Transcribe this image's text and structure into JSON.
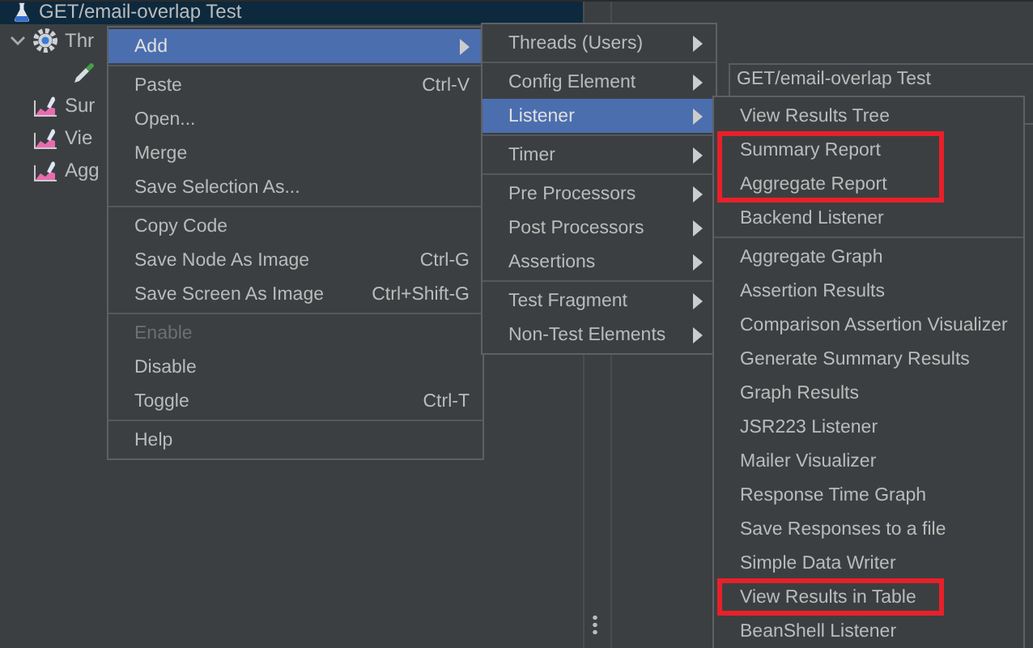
{
  "tree": [
    {
      "label": "GET/email-overlap Test",
      "kind": "test-plan",
      "selected": true,
      "children": [
        {
          "label": "Thr",
          "kind": "thread-group",
          "selected": false,
          "expanded": true,
          "children": [
            {
              "kind": "sampler",
              "selected": false
            }
          ]
        },
        {
          "label": "Sur",
          "kind": "listener",
          "selected": false
        },
        {
          "label": "Vie",
          "kind": "listener",
          "selected": false
        },
        {
          "label": "Agg",
          "kind": "listener",
          "selected": false
        }
      ]
    }
  ],
  "panel": {
    "title": "GET/email-overlap Test"
  },
  "context_menu": {
    "sections": [
      [
        {
          "label": "Add",
          "submenu": true,
          "selected": true,
          "disabled": false
        }
      ],
      [
        {
          "label": "Paste",
          "shortcut": "Ctrl-V",
          "submenu": false,
          "selected": false,
          "disabled": false
        },
        {
          "label": "Open...",
          "submenu": false,
          "selected": false,
          "disabled": false
        },
        {
          "label": "Merge",
          "submenu": false,
          "selected": false,
          "disabled": false
        },
        {
          "label": "Save Selection As...",
          "submenu": false,
          "selected": false,
          "disabled": false
        }
      ],
      [
        {
          "label": "Copy Code",
          "submenu": false,
          "selected": false,
          "disabled": false
        },
        {
          "label": "Save Node As Image",
          "shortcut": "Ctrl-G",
          "submenu": false,
          "selected": false,
          "disabled": false
        },
        {
          "label": "Save Screen As Image",
          "shortcut": "Ctrl+Shift-G",
          "submenu": false,
          "selected": false,
          "disabled": false
        }
      ],
      [
        {
          "label": "Enable",
          "submenu": false,
          "selected": false,
          "disabled": true
        },
        {
          "label": "Disable",
          "submenu": false,
          "selected": false,
          "disabled": false
        },
        {
          "label": "Toggle",
          "shortcut": "Ctrl-T",
          "submenu": false,
          "selected": false,
          "disabled": false
        }
      ],
      [
        {
          "label": "Help",
          "submenu": false,
          "selected": false,
          "disabled": false
        }
      ]
    ]
  },
  "add_menu": {
    "sections": [
      [
        {
          "label": "Threads (Users)",
          "selected": false
        }
      ],
      [
        {
          "label": "Config Element",
          "selected": false
        },
        {
          "label": "Listener",
          "selected": true
        }
      ],
      [
        {
          "label": "Timer",
          "selected": false
        }
      ],
      [
        {
          "label": "Pre Processors",
          "selected": false
        },
        {
          "label": "Post Processors",
          "selected": false
        },
        {
          "label": "Assertions",
          "selected": false
        }
      ],
      [
        {
          "label": "Test Fragment",
          "selected": false
        },
        {
          "label": "Non-Test Elements",
          "selected": false
        }
      ]
    ]
  },
  "listener_menu": {
    "sections": [
      [
        {
          "label": "View Results Tree",
          "highlighted": false
        },
        {
          "label": "Summary Report",
          "highlighted": true
        },
        {
          "label": "Aggregate Report",
          "highlighted": true
        },
        {
          "label": "Backend Listener",
          "highlighted": false
        }
      ],
      [
        {
          "label": "Aggregate Graph",
          "highlighted": false
        },
        {
          "label": "Assertion Results",
          "highlighted": false
        },
        {
          "label": "Comparison Assertion Visualizer",
          "highlighted": false
        },
        {
          "label": "Generate Summary Results",
          "highlighted": false
        },
        {
          "label": "Graph Results",
          "highlighted": false
        },
        {
          "label": "JSR223 Listener",
          "highlighted": false
        },
        {
          "label": "Mailer Visualizer",
          "highlighted": false
        },
        {
          "label": "Response Time Graph",
          "highlighted": false
        },
        {
          "label": "Save Responses to a file",
          "highlighted": false
        },
        {
          "label": "Simple Data Writer",
          "highlighted": false
        },
        {
          "label": "View Results in Table",
          "highlighted": true
        },
        {
          "label": "BeanShell Listener",
          "highlighted": false
        }
      ]
    ]
  }
}
